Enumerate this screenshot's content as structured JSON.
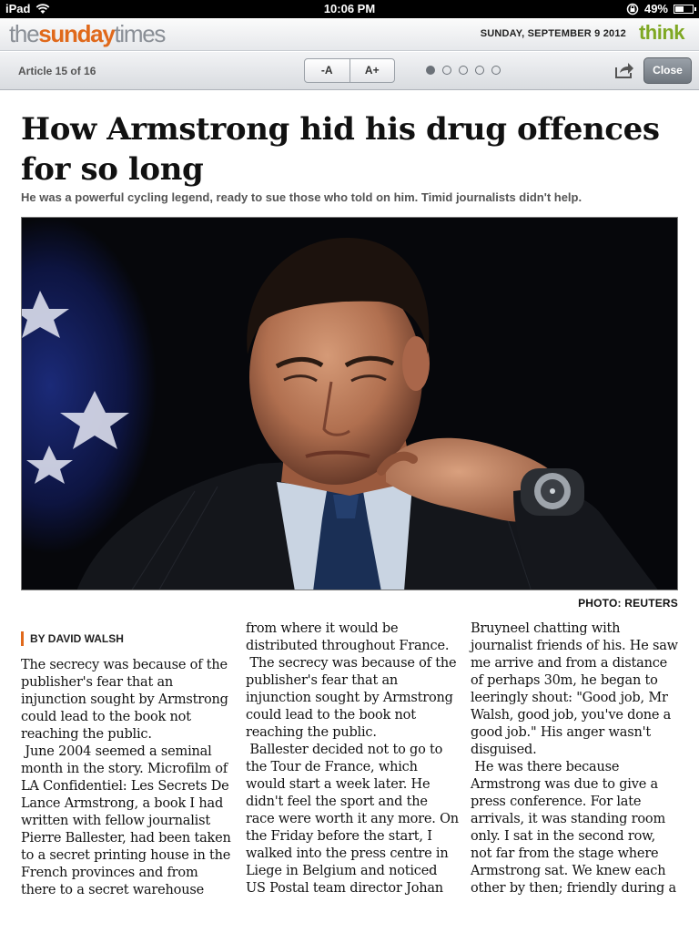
{
  "statusbar": {
    "device": "iPad",
    "time": "10:06 PM",
    "battery": "49%",
    "battery_level": 0.49
  },
  "masthead": {
    "logo": {
      "part1": "the",
      "part2": "sunday",
      "part3": "times"
    },
    "date": "SUNDAY, SEPTEMBER 9 2012",
    "section": "think"
  },
  "toolbar": {
    "article_count": "Article 15 of 16",
    "font_decrease": "-A",
    "font_increase": "A+",
    "page_dots": {
      "total": 5,
      "active_index": 0
    },
    "share_icon": "share-icon",
    "close_label": "Close"
  },
  "article": {
    "headline": "How Armstrong hid his drug offences for so long",
    "standfirst": "He was a powerful cycling legend, ready to sue those who told on him. Timid journalists didn't help.",
    "photo_credit": "PHOTO: REUTERS",
    "byline": "BY DAVID WALSH",
    "columns": [
      "The secrecy was because of the\npublisher's fear that an\ninjunction sought by Armstrong\ncould lead to the book not\nreaching the public.\n June 2004 seemed a seminal\nmonth in the story. Microfilm of\nLA Confidentiel: Les Secrets De\nLance Armstrong, a book I had\nwritten with fellow journalist\nPierre Ballester, had been taken\nto a secret printing house in the\nFrench provinces and from\nthere to a secret warehouse",
      "from where it would be\ndistributed throughout France.\n The secrecy was because of the\npublisher's fear that an\ninjunction sought by Armstrong\ncould lead to the book not\nreaching the public.\n Ballester decided not to go to\nthe Tour de France, which\nwould start a week later. He\ndidn't feel the sport and the\nrace were worth it any more. On\nthe Friday before the start, I\nwalked into the press centre in\nLiege in Belgium and noticed\nUS Postal team director Johan",
      "Bruyneel chatting with\njournalist friends of his. He saw\nme arrive and from a distance\nof perhaps 30m, he began to\nleeringly shout: \"Good job, Mr\nWalsh, good job, you've done a\ngood job.\" His anger wasn't\ndisguised.\n He was there because\nArmstrong was due to give a\npress conference. For late\narrivals, it was standing room\nonly. I sat in the second row,\nnot far from the stage where\nArmstrong sat. We knew each\nother by then; friendly during a"
    ]
  },
  "colors": {
    "brand_orange": "#e0691b",
    "section_green": "#7fa823"
  }
}
